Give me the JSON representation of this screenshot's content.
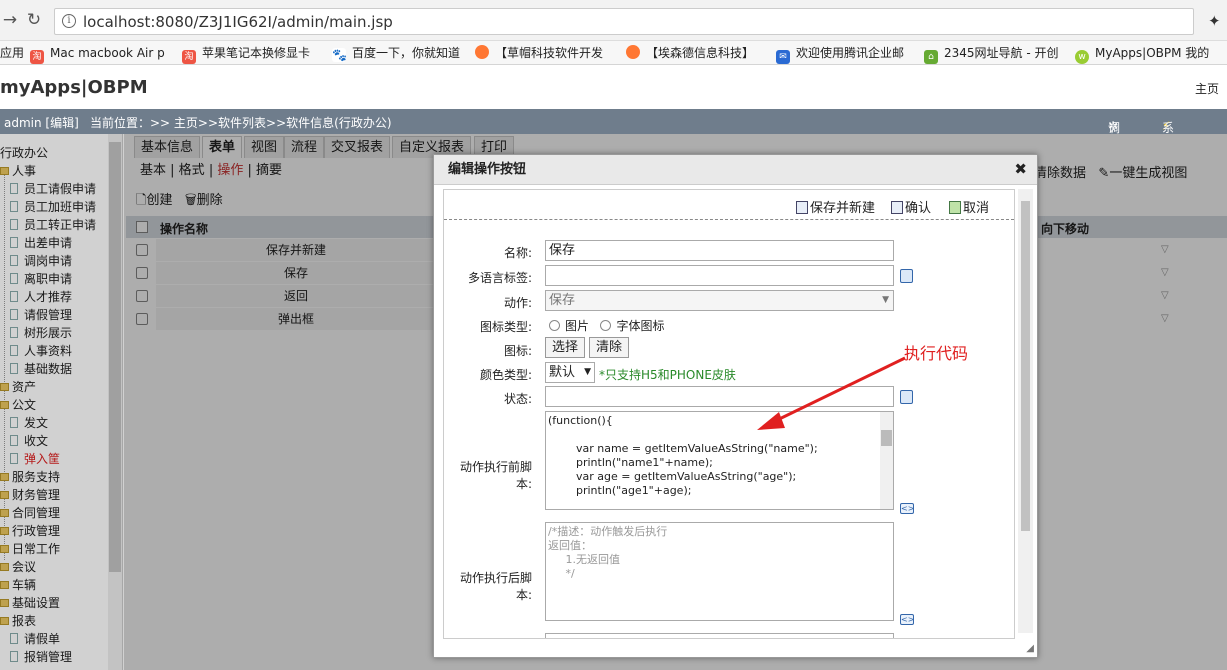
{
  "browser": {
    "url": "localhost:8080/Z3J1IG62I/admin/main.jsp",
    "bookmarks": [
      "应用",
      "Mac macbook Air p",
      "苹果笔记本换修显卡",
      "百度一下，你就知道",
      "【草帽科技软件开发",
      "【埃森德信息科技】",
      "欢迎使用腾讯企业邮",
      "2345网址导航 - 开创",
      "MyApps|OBPM 我的"
    ]
  },
  "app": {
    "logo": "myApps|OBPM",
    "home": "主页",
    "user": "admin [编辑]",
    "breadcrumb": "当前位置：>> 主页>>软件列表>>软件信息(行政办公)",
    "debug": "调试",
    "monitor": "系统监控"
  },
  "sidebar": {
    "root": "行政办公",
    "items": [
      {
        "label": "人事",
        "type": "folder"
      },
      {
        "label": "员工请假申请",
        "type": "doc"
      },
      {
        "label": "员工加班申请",
        "type": "doc"
      },
      {
        "label": "员工转正申请",
        "type": "doc"
      },
      {
        "label": "出差申请",
        "type": "doc"
      },
      {
        "label": "调岗申请",
        "type": "doc"
      },
      {
        "label": "离职申请",
        "type": "doc"
      },
      {
        "label": "人才推荐",
        "type": "doc"
      },
      {
        "label": "请假管理",
        "type": "doc"
      },
      {
        "label": "树形展示",
        "type": "doc"
      },
      {
        "label": "人事资料",
        "type": "doc"
      },
      {
        "label": "基础数据",
        "type": "doc"
      },
      {
        "label": "资产",
        "type": "folder"
      },
      {
        "label": "公文",
        "type": "folder"
      },
      {
        "label": "发文",
        "type": "doc"
      },
      {
        "label": "收文",
        "type": "doc"
      },
      {
        "label": "弹入筐",
        "type": "doc",
        "active": true
      },
      {
        "label": "服务支持",
        "type": "folder"
      },
      {
        "label": "财务管理",
        "type": "folder"
      },
      {
        "label": "合同管理",
        "type": "folder"
      },
      {
        "label": "行政管理",
        "type": "folder"
      },
      {
        "label": "日常工作",
        "type": "folder"
      },
      {
        "label": "会议",
        "type": "folder"
      },
      {
        "label": "车辆",
        "type": "folder"
      },
      {
        "label": "基础设置",
        "type": "folder"
      },
      {
        "label": "报表",
        "type": "folder"
      },
      {
        "label": "请假单",
        "type": "doc"
      },
      {
        "label": "报销管理",
        "type": "doc"
      }
    ]
  },
  "main": {
    "tabs": [
      "基本信息",
      "表单",
      "视图",
      "流程",
      "交叉报表",
      "自定义报表",
      "打印"
    ],
    "subtabs": [
      "基本",
      "格式",
      "操作",
      "摘要"
    ],
    "create": "创建",
    "delete": "删除",
    "col_name": "操作名称",
    "col_move": "向下移动",
    "clear_data": "清除数据",
    "gen_view": "一键生成视图",
    "rows": [
      "保存并新建",
      "保存",
      "返回",
      "弹出框"
    ]
  },
  "dialog": {
    "title": "编辑操作按钮",
    "save_new": "保存并新建",
    "confirm": "确认",
    "cancel": "取消",
    "name_label": "名称:",
    "name_value": "保存",
    "multilang_label": "多语言标签:",
    "action_label": "动作:",
    "action_value": "保存",
    "icontype_label": "图标类型:",
    "icontype_img": "图片",
    "icontype_font": "字体图标",
    "icon_label": "图标:",
    "icon_select": "选择",
    "icon_clear": "清除",
    "color_label": "颜色类型:",
    "color_value": "默认",
    "color_hint": "*只支持H5和PHONE皮肤",
    "state_label": "状态:",
    "before_label": "动作执行前脚本:",
    "before_code": "(function(){\n\n        var name = getItemValueAsString(\"name\");\n        println(\"name1\"+name);\n        var age = getItemValueAsString(\"age\");\n        println(\"age1\"+age);",
    "after_label": "动作执行后脚本:",
    "after_code": "/*描述：动作触发后执行\n返回值：\n     1.无返回值\n     */"
  },
  "annotation": "执行代码"
}
